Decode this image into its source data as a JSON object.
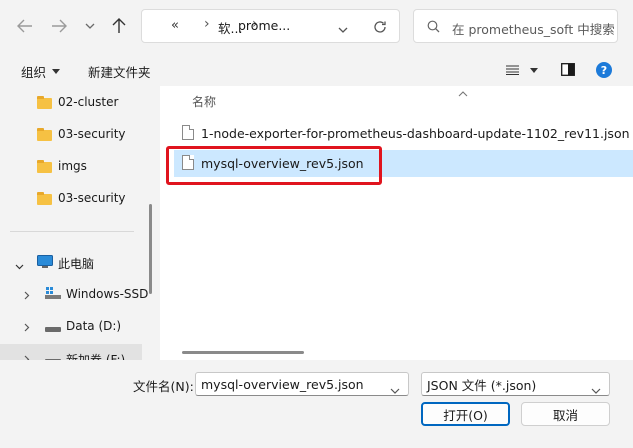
{
  "address": {
    "overflow": "«",
    "crumbs": [
      "软...",
      "prome..."
    ],
    "separator": "›"
  },
  "search": {
    "placeholder": "在 prometheus_soft 中搜索"
  },
  "toolbar": {
    "organize_label": "组织",
    "new_folder_label": "新建文件夹"
  },
  "sidebar": {
    "folders": [
      {
        "label": "02-cluster"
      },
      {
        "label": "03-security"
      },
      {
        "label": "imgs"
      },
      {
        "label": "03-security"
      }
    ],
    "this_pc_label": "此电脑",
    "drives": [
      {
        "label": "Windows-SSD"
      },
      {
        "label": "Data (D:)"
      },
      {
        "label": "新加卷 (F:)"
      }
    ]
  },
  "files": {
    "column_name": "名称",
    "items": [
      {
        "name": "1-node-exporter-for-prometheus-dashboard-update-1102_rev11.json",
        "selected": false
      },
      {
        "name": "mysql-overview_rev5.json",
        "selected": true
      }
    ]
  },
  "bottom": {
    "filename_label": "文件名(N):",
    "filename_value": "mysql-overview_rev5.json",
    "filetype_value": "JSON 文件 (*.json)",
    "open_label": "打开(O)",
    "cancel_label": "取消"
  },
  "colors": {
    "selection": "#cce8ff",
    "highlight_box": "#e0141e",
    "focus_border": "#0067c0",
    "help_icon": "#1c7ad9"
  }
}
